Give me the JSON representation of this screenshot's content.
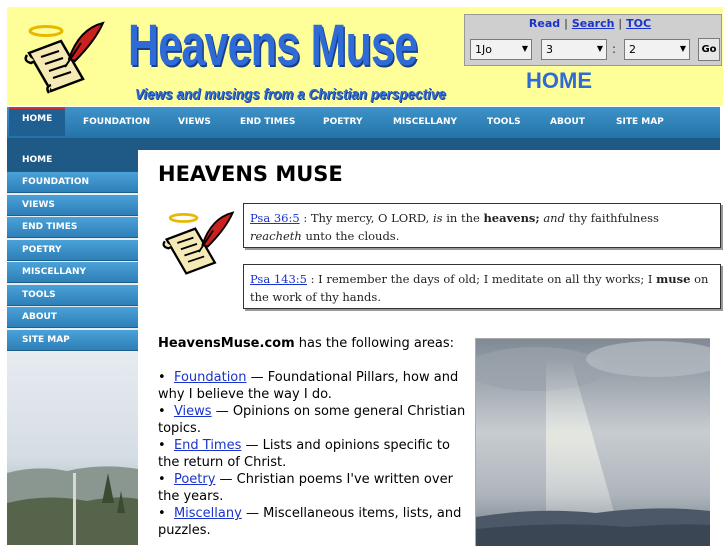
{
  "header": {
    "site_title": "Heavens Muse",
    "tagline": "Views and musings from a Christian perspective",
    "page_label": "HOME"
  },
  "tools": {
    "links": [
      "Read",
      "Search",
      "TOC"
    ],
    "book_select": "1Jo",
    "chapter_select": "3",
    "verse_select": "2",
    "colon": ":",
    "go_label": "Go"
  },
  "top_nav": [
    "HOME",
    "FOUNDATION",
    "VIEWS",
    "END TIMES",
    "POETRY",
    "MISCELLANY",
    "TOOLS",
    "ABOUT",
    "SITE MAP"
  ],
  "side_nav": [
    "HOME",
    "Foundation",
    "Views",
    "End Times",
    "Poetry",
    "Miscellany",
    "Tools",
    "About",
    "Site Map"
  ],
  "main": {
    "title": "HEAVENS MUSE",
    "verses": [
      {
        "ref": "Psa 36:5",
        "sep": " :  ",
        "text_html": "Thy mercy, O LORD, <i>is</i> in the <b>heavens;</b> <i>and</i> thy faithfulness <i>reacheth</i> unto the clouds."
      },
      {
        "ref": "Psa 143:5",
        "sep": " :  ",
        "text_html": "I remember the days of old; I meditate on all thy works; I <b>muse</b> on the work of thy hands."
      }
    ],
    "intro_bold": "HeavensMuse.com",
    "intro_rest": " has the following areas:",
    "areas": [
      {
        "link": "Foundation",
        "desc": " — Foundational Pillars, how and why I believe the way I do."
      },
      {
        "link": "Views",
        "desc": " — Opinions on some general Christian topics."
      },
      {
        "link": "End Times",
        "desc": " — Lists and opinions specific to the return of Christ."
      },
      {
        "link": "Poetry",
        "desc": " — Christian poems I've written over the years."
      },
      {
        "link": "Miscellany",
        "desc": " — Miscellaneous items, lists, and puzzles."
      }
    ]
  },
  "colors": {
    "header_bg": "#ffff99",
    "title_blue": "#2e6bd6",
    "nav_blue": "#2e7fb7",
    "nav_dark": "#1f5a86",
    "link_blue": "#1a33cc"
  }
}
